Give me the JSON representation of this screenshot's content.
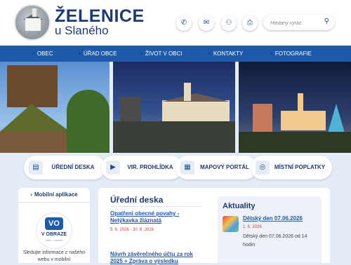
{
  "header": {
    "title_line1": "ŽELENICE",
    "title_line2": "u Slaného",
    "icons": [
      "phone-icon",
      "mail-icon",
      "sitemap-icon",
      "print-icon"
    ],
    "search_placeholder": "Hledaný výraz"
  },
  "nav": {
    "items": [
      {
        "label": "OBEC",
        "icon": "home-icon"
      },
      {
        "label": "ÚŘAD OBCE",
        "icon": "office-icon"
      },
      {
        "label": "ŽIVOT V OBCI",
        "icon": "life-icon"
      },
      {
        "label": "KONTAKTY",
        "icon": "contacts-icon"
      },
      {
        "label": "FOTOGRAFIE",
        "icon": "photo-icon"
      }
    ]
  },
  "quick_links": [
    {
      "label": "ÚŘEDNÍ DESKA",
      "icon": "board-icon"
    },
    {
      "label": "VIR. PROHLÍDKA",
      "icon": "camera-icon"
    },
    {
      "label": "MAPOVÝ PORTÁL",
      "icon": "map-icon"
    },
    {
      "label": "MÍSTNÍ POPLATKY",
      "icon": "coins-icon"
    }
  ],
  "sidebar": {
    "title": "Mobilní aplikace",
    "logo_name": "V OBRAZE",
    "logo_sub": "OBEC V OBRAZE",
    "description": "Sledujte informace z našeho webu v mobilní"
  },
  "board": {
    "heading": "Úřední deska",
    "notices": [
      {
        "title": "Opatření obecné povahy - Netýkavka žláznatá",
        "date": "5. 6. 2026 - 30. 6. 2026"
      },
      {
        "title": "Návrh závěrečného účtu za rok 2025 + Zpráva o výsledku"
      }
    ]
  },
  "news": {
    "heading": "Aktuality",
    "items": [
      {
        "title": "Dětský den 07.06.2026",
        "date": "1. 6. 2026",
        "text": "Dětský den 07.06.2026 od 14 hodin"
      }
    ]
  },
  "colors": {
    "primary": "#1e5aa8",
    "dark": "#1f3a6e",
    "background": "#e4ecf5",
    "date_red": "#d23b3b"
  }
}
